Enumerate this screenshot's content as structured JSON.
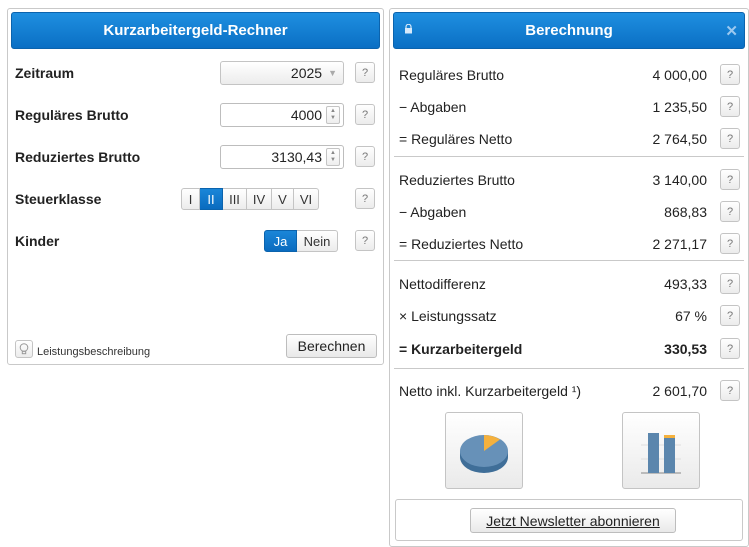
{
  "left": {
    "title": "Kurzarbeitergeld-Rechner",
    "help": "?",
    "rows": {
      "period": {
        "label": "Zeitraum",
        "value": "2025"
      },
      "regular_gross": {
        "label": "Reguläres Brutto",
        "value": "4000"
      },
      "reduced_gross": {
        "label": "Reduziertes Brutto",
        "value": "3130,43"
      },
      "tax_class": {
        "label": "Steuerklasse",
        "options": [
          "I",
          "II",
          "III",
          "IV",
          "V",
          "VI"
        ],
        "selected": "II"
      },
      "children": {
        "label": "Kinder",
        "options": [
          "Ja",
          "Nein"
        ],
        "selected": "Ja"
      }
    },
    "info_link": "Leistungsbeschreibung",
    "calc_button": "Berechnen"
  },
  "right": {
    "title": "Berechnung",
    "help": "?",
    "rows": [
      {
        "label": "Reguläres Brutto",
        "value": "4 000,00"
      },
      {
        "label": "− Abgaben",
        "value": "1 235,50"
      },
      {
        "label": "= Reguläres Netto",
        "value": "2 764,50"
      },
      {
        "label": "Reduziertes Brutto",
        "value": "3 140,00"
      },
      {
        "label": "− Abgaben",
        "value": "868,83"
      },
      {
        "label": "= Reduziertes Netto",
        "value": "2 271,17"
      },
      {
        "label": "Nettodifferenz",
        "value": "493,33"
      },
      {
        "label": "× Leistungssatz",
        "value": "67 %"
      },
      {
        "label": "= Kurzarbeitergeld",
        "value": "330,53"
      },
      {
        "label": "Netto inkl. Kurzarbeitergeld ¹)",
        "value": "2 601,70"
      }
    ],
    "newsletter_button": "Jetzt Newsletter abonnieren"
  },
  "colors": {
    "header_blue": "#0a6fc4",
    "chart_blue": "#5b86ad",
    "chart_orange": "#f5b13d"
  },
  "icons": [
    "lock-icon",
    "close-icon",
    "help-icon",
    "lightbulb-icon",
    "pie-chart-icon",
    "bar-chart-icon",
    "caret-down-icon",
    "spinner-icon"
  ]
}
